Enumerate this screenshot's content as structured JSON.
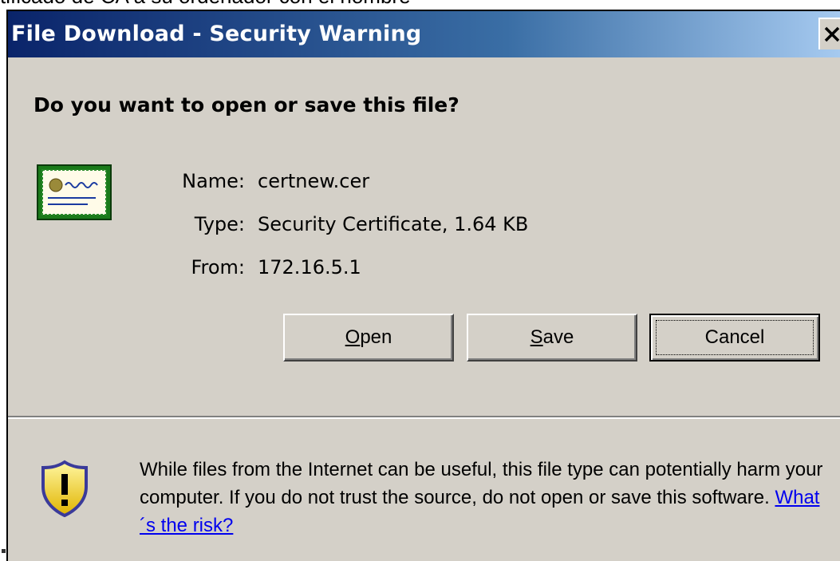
{
  "background": {
    "partial_text": "tificado de CA a su ordenador con el nombre"
  },
  "dialog": {
    "title": "File Download - Security Warning",
    "close_label": "X",
    "question": "Do you want to open or save this file?",
    "file_icon": "certificate-icon",
    "fields": [
      {
        "label": "Name:",
        "value": "certnew.cer"
      },
      {
        "label": "Type:",
        "value": "Security Certificate, 1.64 KB"
      },
      {
        "label": "From:",
        "value": "172.16.5.1"
      }
    ],
    "buttons": {
      "open": {
        "prefix": "",
        "mnemonic": "O",
        "rest": "pen"
      },
      "save": {
        "prefix": "",
        "mnemonic": "S",
        "rest": "ave"
      },
      "cancel": {
        "label": "Cancel"
      }
    },
    "warning": {
      "icon": "shield-warning-icon",
      "text": "While files from the Internet can be useful, this file type can potentially harm your computer. If you do not trust the source, do not open or save this software.",
      "link": "What´s the risk?"
    }
  },
  "colors": {
    "titlebar_start": "#0a246a",
    "titlebar_end": "#a6caf0",
    "dialog_bg": "#d4d0c8",
    "link": "#0000ee"
  }
}
